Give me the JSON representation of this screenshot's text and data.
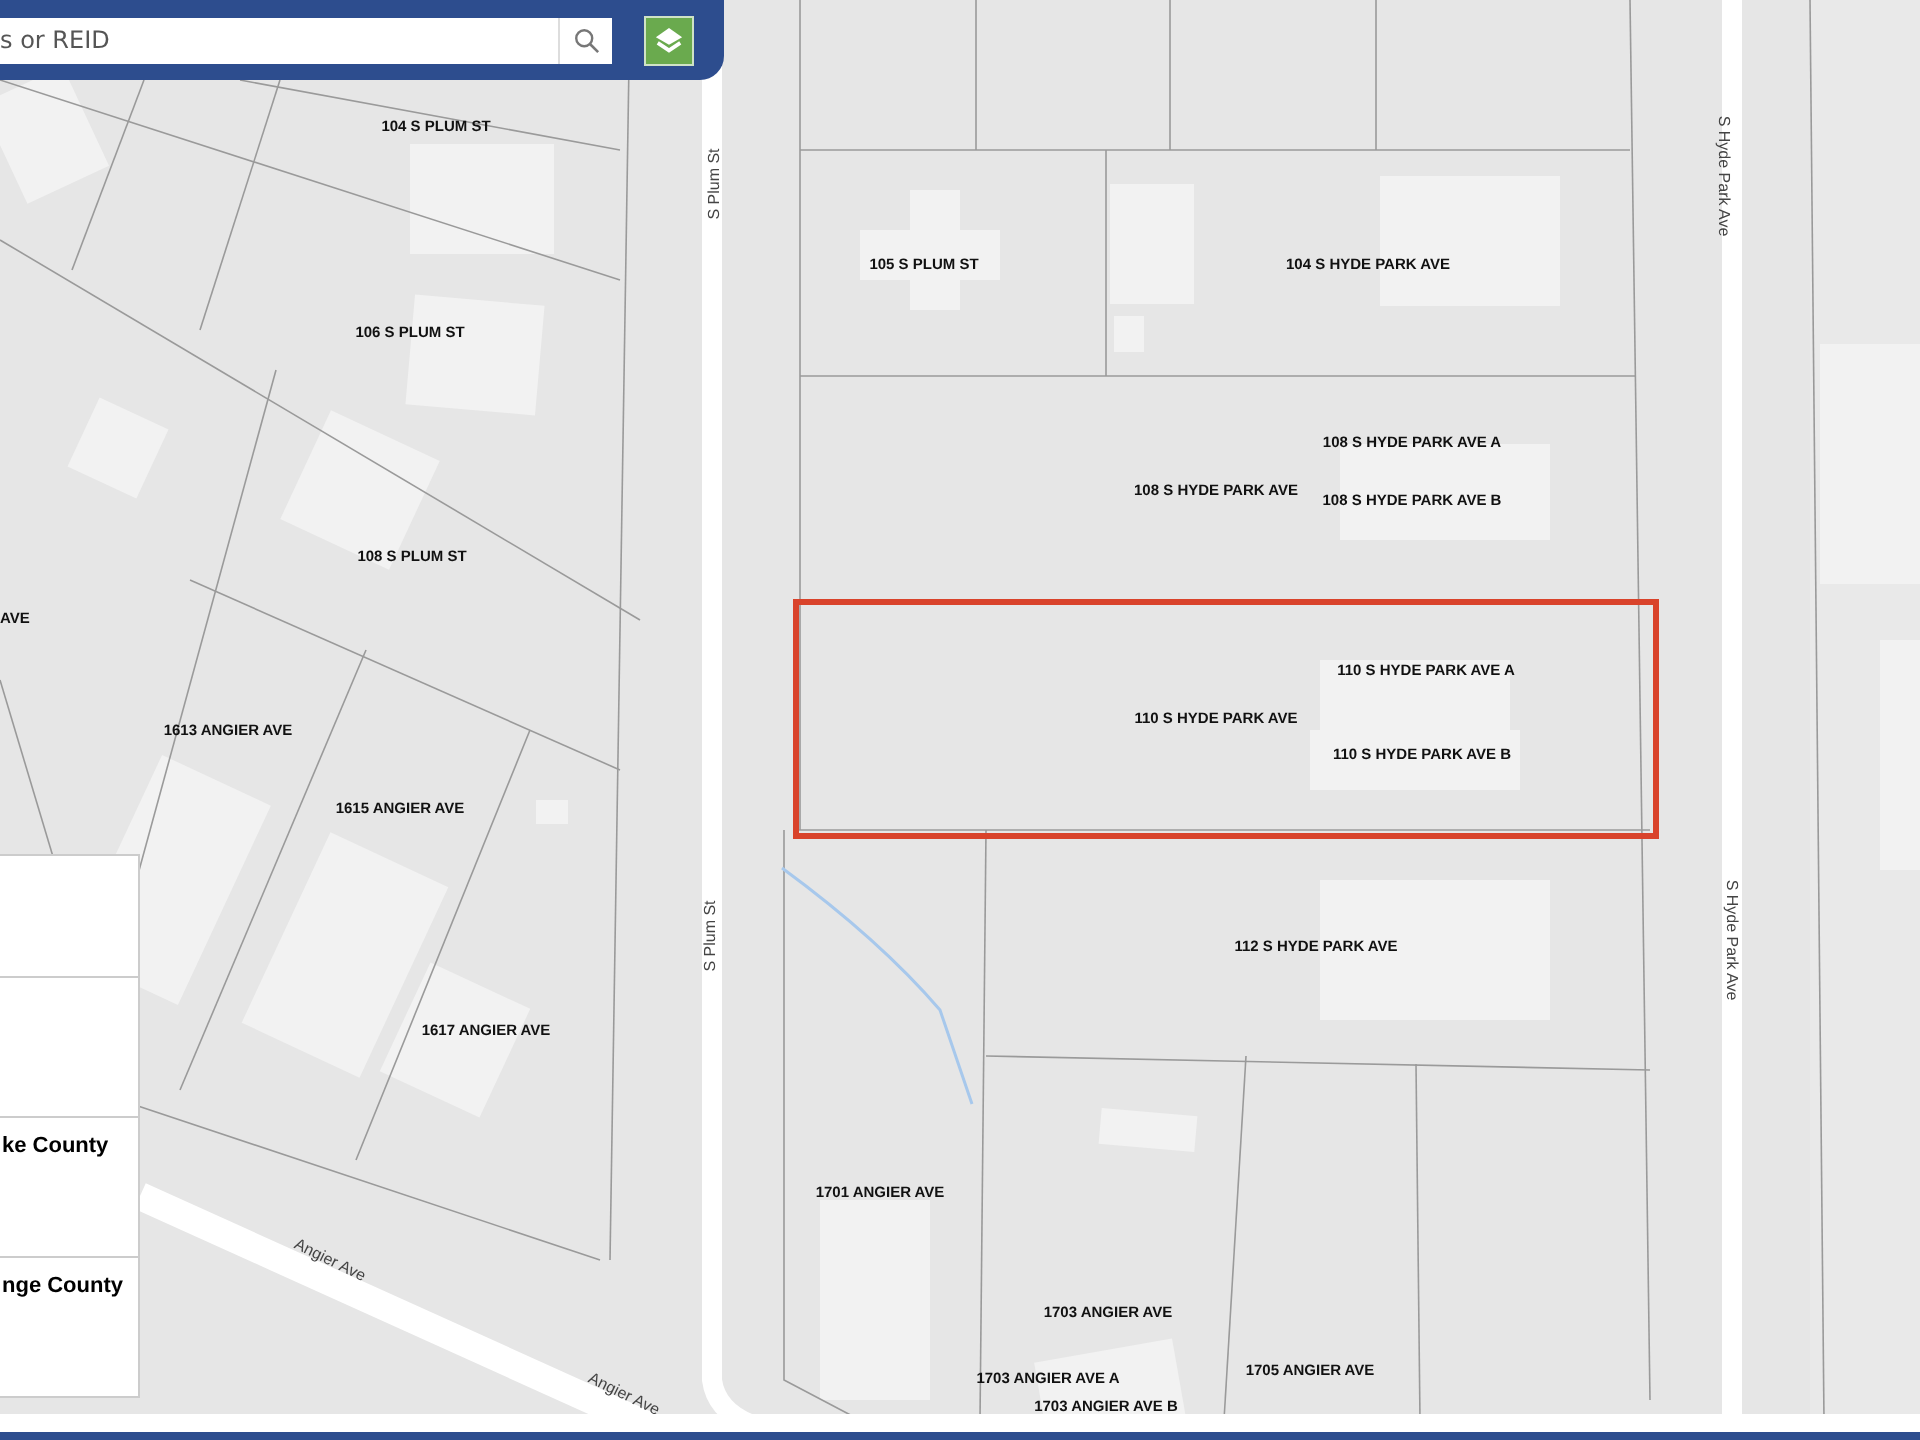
{
  "search": {
    "placeholder": "s or REID"
  },
  "side_panel": {
    "rows": [
      {
        "label": ""
      },
      {
        "label": ""
      },
      {
        "label": "ke County"
      },
      {
        "label": "nge County"
      }
    ]
  },
  "parcel_labels": [
    {
      "text": "104 S PLUM ST",
      "selected": false
    },
    {
      "text": "106 S PLUM ST",
      "selected": false
    },
    {
      "text": "108 S PLUM ST",
      "selected": false
    },
    {
      "text": "AVE",
      "selected": false
    },
    {
      "text": "105 S PLUM ST",
      "selected": false
    },
    {
      "text": "104 S HYDE PARK AVE",
      "selected": false
    },
    {
      "text": "108 S HYDE PARK AVE A",
      "selected": false
    },
    {
      "text": "108 S HYDE PARK AVE",
      "selected": false
    },
    {
      "text": "108 S HYDE PARK AVE B",
      "selected": false
    },
    {
      "text": "110 S HYDE PARK AVE A",
      "selected": false
    },
    {
      "text": "110 S HYDE PARK AVE",
      "selected": true
    },
    {
      "text": "110 S HYDE PARK AVE B",
      "selected": false
    },
    {
      "text": "1613 ANGIER AVE",
      "selected": false
    },
    {
      "text": "1615 ANGIER AVE",
      "selected": false
    },
    {
      "text": "1617 ANGIER AVE",
      "selected": false
    },
    {
      "text": "112 S HYDE PARK AVE",
      "selected": false
    },
    {
      "text": "1701 ANGIER AVE",
      "selected": false
    },
    {
      "text": "1703 ANGIER AVE",
      "selected": false
    },
    {
      "text": "1703 ANGIER AVE A",
      "selected": false
    },
    {
      "text": "1705 ANGIER AVE",
      "selected": false
    },
    {
      "text": "1703 ANGIER AVE B",
      "selected": false
    }
  ],
  "street_labels": [
    "S Plum St",
    "S Plum St",
    "S Hyde Park Ave",
    "S Hyde Park Ave",
    "Angier Ave",
    "Angier Ave"
  ]
}
